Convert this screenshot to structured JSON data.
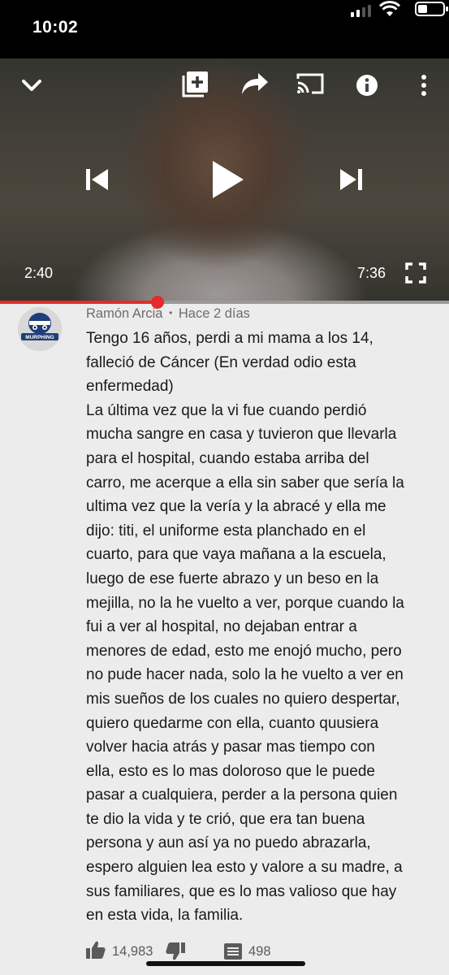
{
  "status_bar": {
    "time": "10:02"
  },
  "player": {
    "elapsed": "2:40",
    "duration": "7:36",
    "progress_fraction": 0.351
  },
  "comment": {
    "author": "Ramón Arcia",
    "separator": "•",
    "posted": "Hace 2 días",
    "avatar_label": "MURPHING",
    "text": "Tengo 16 años, perdi a mi mama a los 14,\nfalleció de Cáncer (En verdad odio esta\nenfermedad)\nLa última vez que la vi fue cuando perdió\nmucha sangre en casa y tuvieron que llevarla\npara el hospital, cuando estaba arriba del\ncarro, me acerque a ella sin saber que sería la\nultima vez que la vería y la abracé y ella me\ndijo: titi, el uniforme esta planchado en el\ncuarto, para que vaya mañana a la escuela,\nluego de ese fuerte abrazo y un beso en la\nmejilla, no la he vuelto a ver, porque cuando la\nfui a ver al hospital, no dejaban entrar a\nmenores de edad, esto me enojó mucho, pero\nno pude hacer nada, solo la he vuelto a ver en\nmis sueños de los cuales no quiero despertar,\nquiero quedarme con ella, cuanto quusiera\nvolver hacia atrás y pasar mas tiempo con\nella, esto es lo mas doloroso que le puede\npasar a cualquiera, perder a la persona quien\nte dio la vida y te crió, que era tan buena\npersona y aun así ya no puedo abrazarla,\nespero alguien lea esto y valore a su madre, a\nsus familiares, que es lo mas valioso que hay\nen esta vida, la familia.",
    "likes": "14,983",
    "replies": "498"
  },
  "colors": {
    "accent": "#e52b2b",
    "background": "#ececec"
  }
}
